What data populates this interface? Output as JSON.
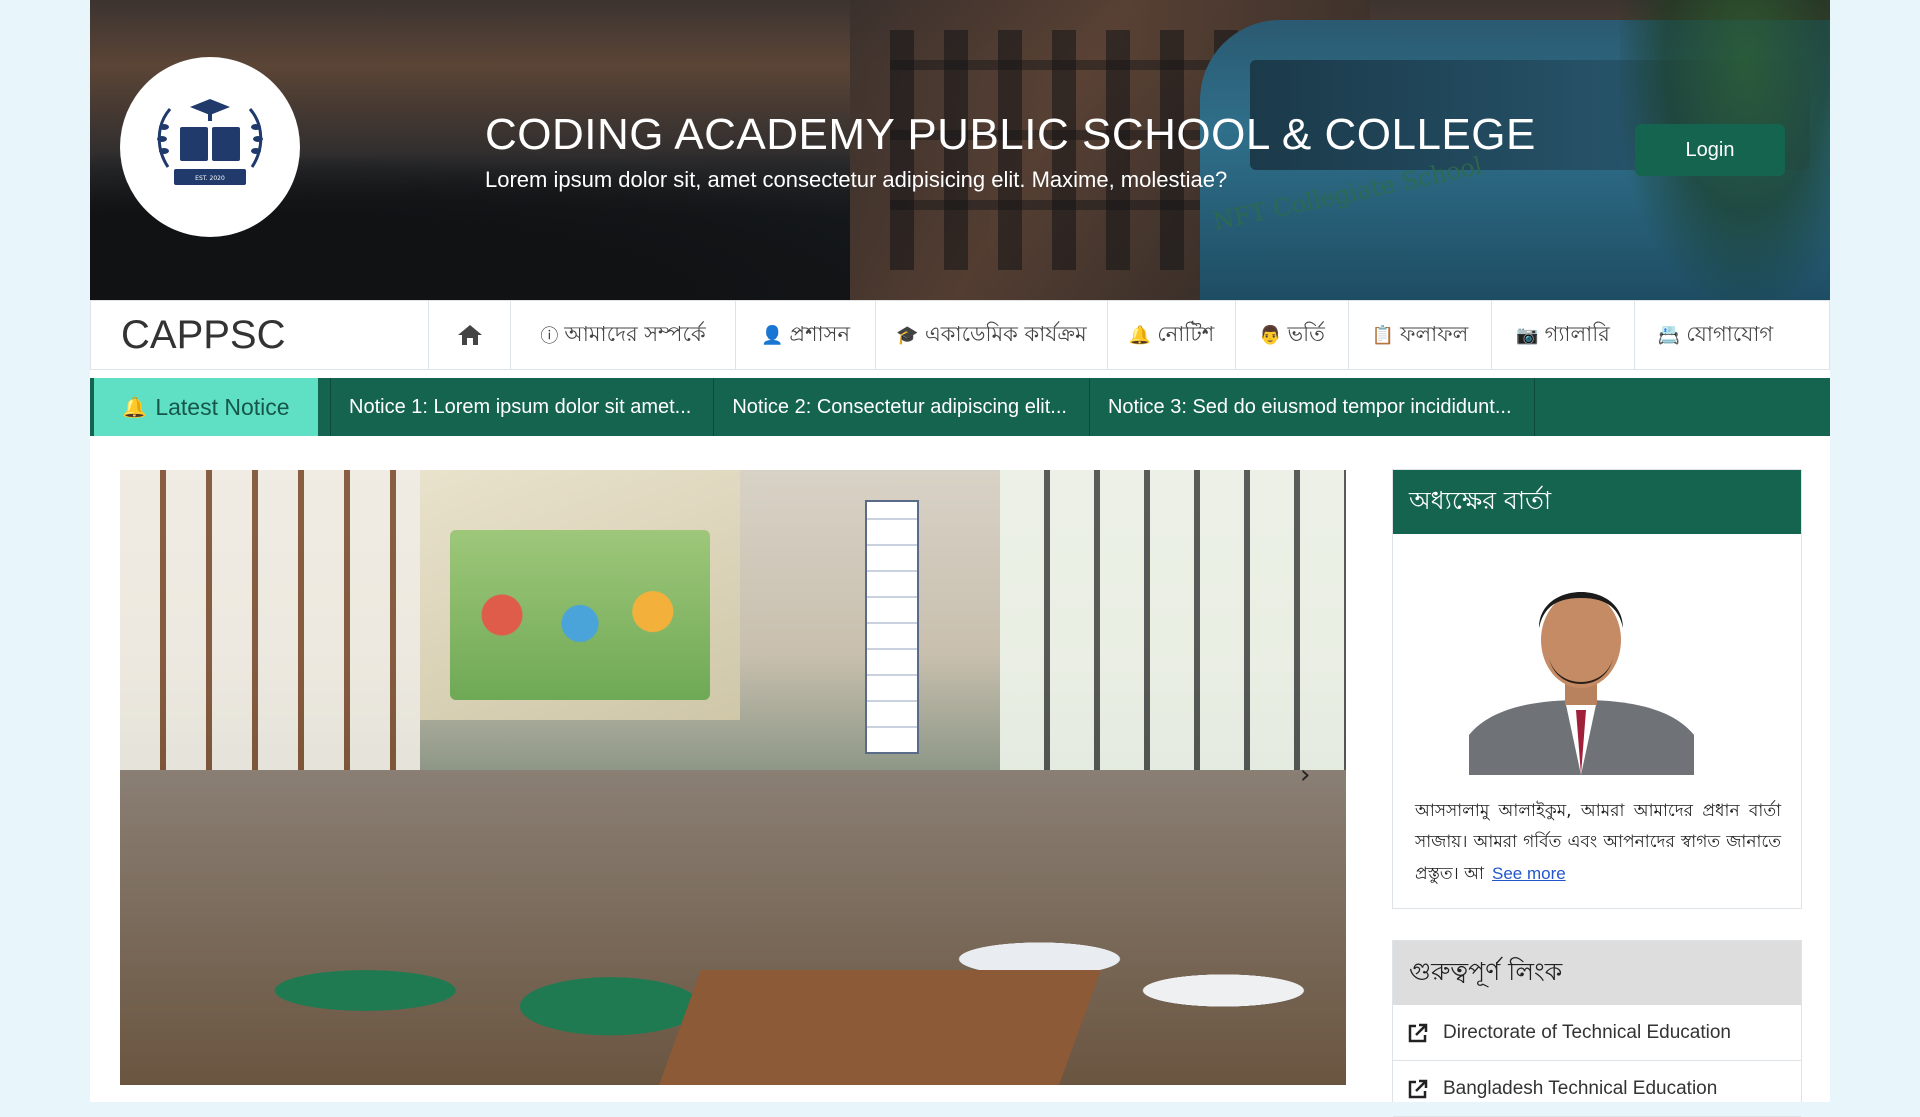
{
  "header": {
    "title": "CODING ACADEMY PUBLIC SCHOOL & COLLEGE",
    "subtitle": "Lorem ipsum dolor sit, amet consectetur adipisicing elit. Maxime, molestiae?",
    "login_label": "Login",
    "logo_icon": "school-book-logo",
    "bus_text": "NFT Collegiate School"
  },
  "nav": {
    "brand": "CAPPSC",
    "home_icon": "home-icon",
    "items": [
      {
        "label": "আমাদের সম্পর্কে",
        "icon": "info-icon"
      },
      {
        "label": "প্রশাসন",
        "icon": "user-icon"
      },
      {
        "label": "একাডেমিক কার্যক্রম",
        "icon": "graduation-cap-icon"
      },
      {
        "label": "নোটিশ",
        "icon": "bell-icon"
      },
      {
        "label": "ভর্তি",
        "icon": "user-graduate-icon"
      },
      {
        "label": "ফলাফল",
        "icon": "clipboard-check-icon"
      },
      {
        "label": "গ্যালারি",
        "icon": "image-icon"
      },
      {
        "label": "যোগাযোগ",
        "icon": "contact-card-icon"
      }
    ]
  },
  "notice": {
    "label": "Latest Notice",
    "items": [
      "Notice 1: Lorem ipsum dolor sit amet...",
      "Notice 2: Consectetur adipiscing elit...",
      "Notice 3: Sed do eiusmod tempor incididunt..."
    ]
  },
  "slider": {
    "next_label": "›"
  },
  "principal": {
    "heading": "অধ্যক্ষের বার্তা",
    "message": "আসসালামু আলাইকুম, আমরা আমাদের প্রধান বার্তা সাজায়। আমরা গর্বিত এবং আপনাদের স্বাগত জানাতে প্রস্তুত। আ",
    "see_more": "See more"
  },
  "links": {
    "heading": "গুরুত্বপূর্ণ লিংক",
    "items": [
      "Directorate of Technical Education",
      "Bangladesh Technical Education"
    ]
  },
  "colors": {
    "primary": "#146450",
    "accent": "#5fe0c4",
    "page_bg": "#e8f6fb"
  }
}
